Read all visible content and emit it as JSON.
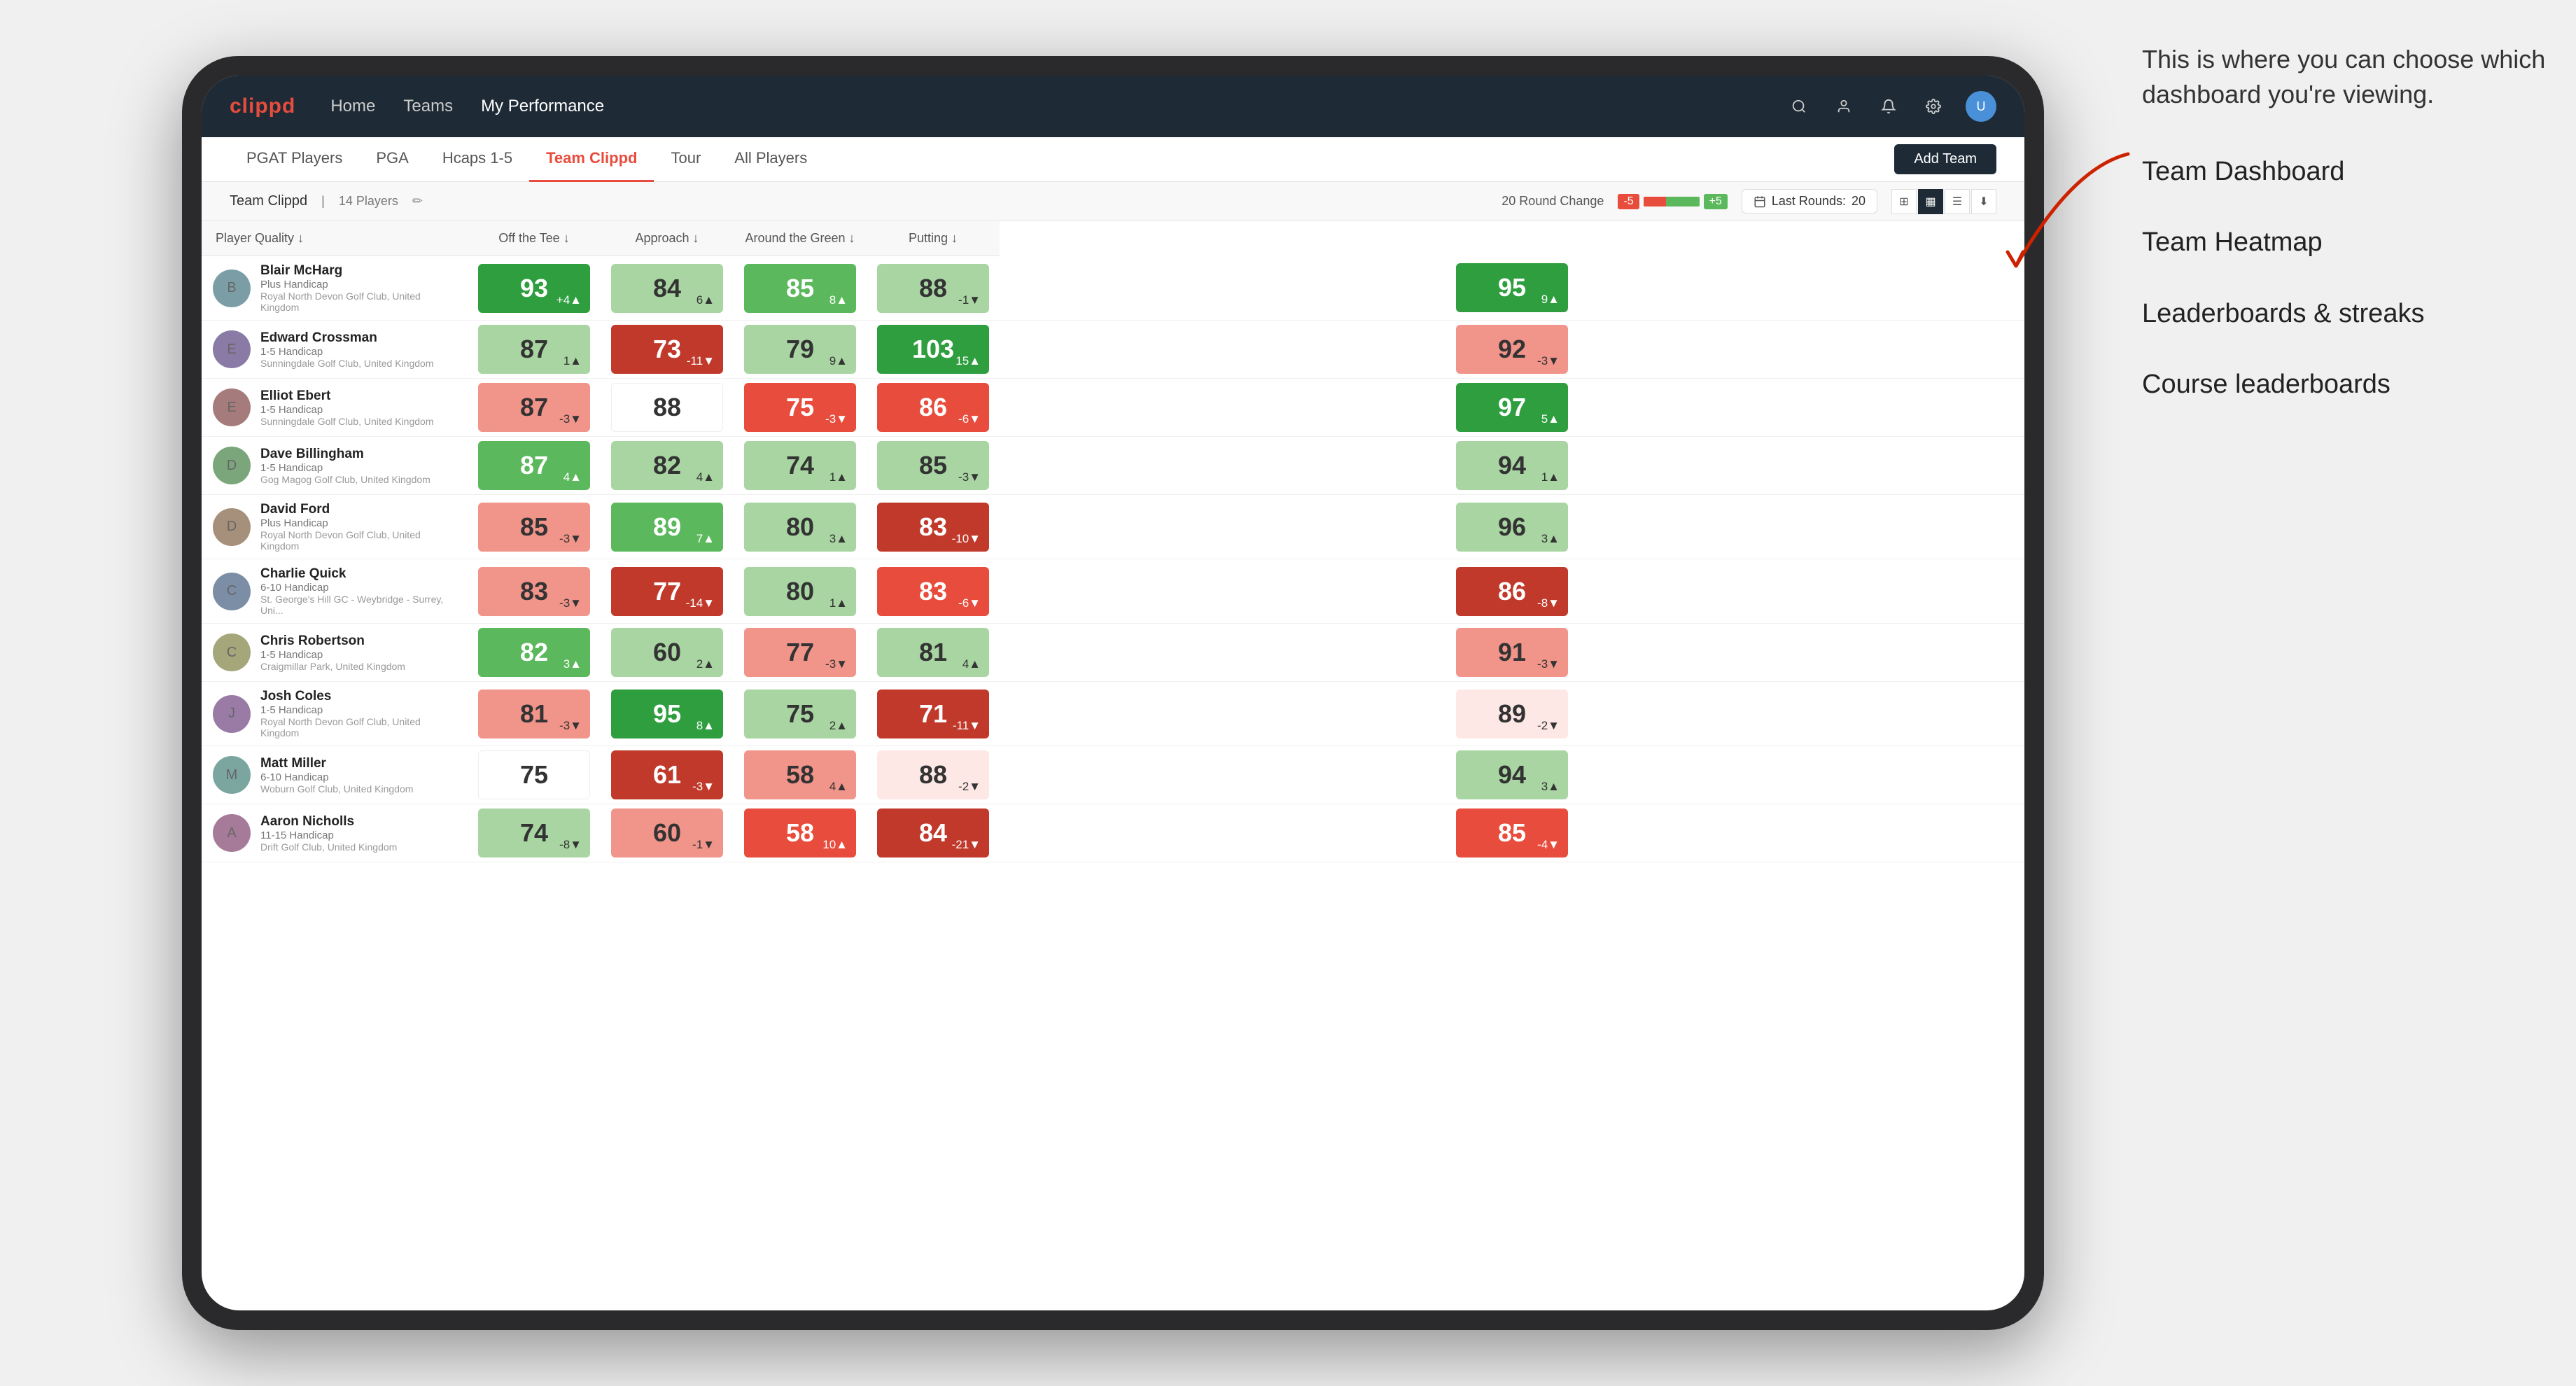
{
  "annotation": {
    "bubble_text": "This is where you can choose which dashboard you're viewing.",
    "items": [
      "Team Dashboard",
      "Team Heatmap",
      "Leaderboards & streaks",
      "Course leaderboards"
    ]
  },
  "nav": {
    "logo": "clippd",
    "links": [
      "Home",
      "Teams",
      "My Performance"
    ],
    "active_link": "My Performance"
  },
  "sub_tabs": [
    "PGAT Players",
    "PGA",
    "Hcaps 1-5",
    "Team Clippd",
    "Tour",
    "All Players"
  ],
  "active_sub_tab": "Team Clippd",
  "add_team_label": "Add Team",
  "team_info": {
    "name": "Team Clippd",
    "count": "14 Players",
    "round_change_label": "20 Round Change",
    "change_neg": "-5",
    "change_pos": "+5",
    "last_rounds_label": "Last Rounds:",
    "last_rounds_value": "20"
  },
  "table": {
    "headers": [
      "Player Quality ↓",
      "Off the Tee ↓",
      "Approach ↓",
      "Around the Green ↓",
      "Putting ↓"
    ],
    "rows": [
      {
        "name": "Blair McHarg",
        "handicap": "Plus Handicap",
        "club": "Royal North Devon Golf Club, United Kingdom",
        "scores": [
          {
            "value": 93,
            "change": "+4",
            "dir": "up",
            "color": "green-dark"
          },
          {
            "value": 84,
            "change": "6",
            "dir": "up",
            "color": "green-light"
          },
          {
            "value": 85,
            "change": "8",
            "dir": "up",
            "color": "green-med"
          },
          {
            "value": 88,
            "change": "-1",
            "dir": "down",
            "color": "green-light"
          },
          {
            "value": 95,
            "change": "9",
            "dir": "up",
            "color": "green-dark"
          }
        ]
      },
      {
        "name": "Edward Crossman",
        "handicap": "1-5 Handicap",
        "club": "Sunningdale Golf Club, United Kingdom",
        "scores": [
          {
            "value": 87,
            "change": "1",
            "dir": "up",
            "color": "green-light"
          },
          {
            "value": 73,
            "change": "-11",
            "dir": "down",
            "color": "red-dark"
          },
          {
            "value": 79,
            "change": "9",
            "dir": "up",
            "color": "green-light"
          },
          {
            "value": 103,
            "change": "15",
            "dir": "up",
            "color": "green-dark"
          },
          {
            "value": 92,
            "change": "-3",
            "dir": "down",
            "color": "red-light"
          }
        ]
      },
      {
        "name": "Elliot Ebert",
        "handicap": "1-5 Handicap",
        "club": "Sunningdale Golf Club, United Kingdom",
        "scores": [
          {
            "value": 87,
            "change": "-3",
            "dir": "down",
            "color": "red-light"
          },
          {
            "value": 88,
            "change": "",
            "dir": "",
            "color": "white-bg"
          },
          {
            "value": 75,
            "change": "-3",
            "dir": "down",
            "color": "red-med"
          },
          {
            "value": 86,
            "change": "-6",
            "dir": "down",
            "color": "red-med"
          },
          {
            "value": 97,
            "change": "5",
            "dir": "up",
            "color": "green-dark"
          }
        ]
      },
      {
        "name": "Dave Billingham",
        "handicap": "1-5 Handicap",
        "club": "Gog Magog Golf Club, United Kingdom",
        "scores": [
          {
            "value": 87,
            "change": "4",
            "dir": "up",
            "color": "green-med"
          },
          {
            "value": 82,
            "change": "4",
            "dir": "up",
            "color": "green-light"
          },
          {
            "value": 74,
            "change": "1",
            "dir": "up",
            "color": "green-light"
          },
          {
            "value": 85,
            "change": "-3",
            "dir": "down",
            "color": "green-light"
          },
          {
            "value": 94,
            "change": "1",
            "dir": "up",
            "color": "green-light"
          }
        ]
      },
      {
        "name": "David Ford",
        "handicap": "Plus Handicap",
        "club": "Royal North Devon Golf Club, United Kingdom",
        "scores": [
          {
            "value": 85,
            "change": "-3",
            "dir": "down",
            "color": "red-light"
          },
          {
            "value": 89,
            "change": "7",
            "dir": "up",
            "color": "green-med"
          },
          {
            "value": 80,
            "change": "3",
            "dir": "up",
            "color": "green-light"
          },
          {
            "value": 83,
            "change": "-10",
            "dir": "down",
            "color": "red-dark"
          },
          {
            "value": 96,
            "change": "3",
            "dir": "up",
            "color": "green-light"
          }
        ]
      },
      {
        "name": "Charlie Quick",
        "handicap": "6-10 Handicap",
        "club": "St. George's Hill GC - Weybridge - Surrey, Uni...",
        "scores": [
          {
            "value": 83,
            "change": "-3",
            "dir": "down",
            "color": "red-light"
          },
          {
            "value": 77,
            "change": "-14",
            "dir": "down",
            "color": "red-dark"
          },
          {
            "value": 80,
            "change": "1",
            "dir": "up",
            "color": "green-light"
          },
          {
            "value": 83,
            "change": "-6",
            "dir": "down",
            "color": "red-med"
          },
          {
            "value": 86,
            "change": "-8",
            "dir": "down",
            "color": "red-dark"
          }
        ]
      },
      {
        "name": "Chris Robertson",
        "handicap": "1-5 Handicap",
        "club": "Craigmillar Park, United Kingdom",
        "scores": [
          {
            "value": 82,
            "change": "3",
            "dir": "up",
            "color": "green-med"
          },
          {
            "value": 60,
            "change": "2",
            "dir": "up",
            "color": "green-light"
          },
          {
            "value": 77,
            "change": "-3",
            "dir": "down",
            "color": "red-light"
          },
          {
            "value": 81,
            "change": "4",
            "dir": "up",
            "color": "green-light"
          },
          {
            "value": 91,
            "change": "-3",
            "dir": "down",
            "color": "red-light"
          }
        ]
      },
      {
        "name": "Josh Coles",
        "handicap": "1-5 Handicap",
        "club": "Royal North Devon Golf Club, United Kingdom",
        "scores": [
          {
            "value": 81,
            "change": "-3",
            "dir": "down",
            "color": "red-light"
          },
          {
            "value": 95,
            "change": "8",
            "dir": "up",
            "color": "green-dark"
          },
          {
            "value": 75,
            "change": "2",
            "dir": "up",
            "color": "green-light"
          },
          {
            "value": 71,
            "change": "-11",
            "dir": "down",
            "color": "red-dark"
          },
          {
            "value": 89,
            "change": "-2",
            "dir": "down",
            "color": "pink-light"
          }
        ]
      },
      {
        "name": "Matt Miller",
        "handicap": "6-10 Handicap",
        "club": "Woburn Golf Club, United Kingdom",
        "scores": [
          {
            "value": 75,
            "change": "",
            "dir": "",
            "color": "white-bg"
          },
          {
            "value": 61,
            "change": "-3",
            "dir": "down",
            "color": "red-dark"
          },
          {
            "value": 58,
            "change": "4",
            "dir": "up",
            "color": "red-light"
          },
          {
            "value": 88,
            "change": "-2",
            "dir": "down",
            "color": "pink-light"
          },
          {
            "value": 94,
            "change": "3",
            "dir": "up",
            "color": "green-light"
          }
        ]
      },
      {
        "name": "Aaron Nicholls",
        "handicap": "11-15 Handicap",
        "club": "Drift Golf Club, United Kingdom",
        "scores": [
          {
            "value": 74,
            "change": "-8",
            "dir": "down",
            "color": "green-light"
          },
          {
            "value": 60,
            "change": "-1",
            "dir": "down",
            "color": "red-light"
          },
          {
            "value": 58,
            "change": "10",
            "dir": "up",
            "color": "red-med"
          },
          {
            "value": 84,
            "change": "-21",
            "dir": "down",
            "color": "red-dark"
          },
          {
            "value": 85,
            "change": "-4",
            "dir": "down",
            "color": "red-med"
          }
        ]
      }
    ]
  },
  "colors": {
    "green_dark": "#2e9e3f",
    "green_med": "#5cb85c",
    "green_light": "#a8d5a2",
    "red_dark": "#c0392b",
    "red_med": "#e74c3c",
    "red_light": "#f1948a",
    "pink_light": "#fde8e6",
    "accent": "#e84c3d",
    "nav_bg": "#1e2a35"
  }
}
